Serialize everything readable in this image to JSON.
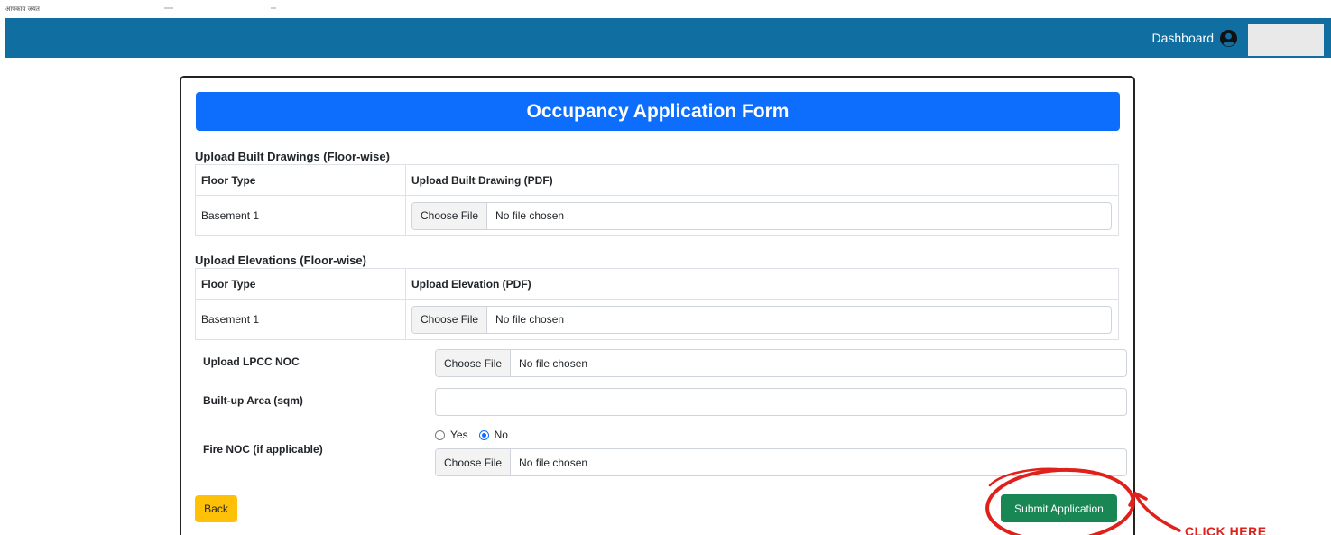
{
  "topbar": {
    "tiny_text": "आपकाय जयत"
  },
  "navbar": {
    "dashboard_label": "Dashboard",
    "user_icon": "user-circle-icon"
  },
  "form": {
    "title": "Occupancy Application Form",
    "built_drawings": {
      "section_title": "Upload Built Drawings (Floor-wise)",
      "headers": [
        "Floor Type",
        "Upload Built Drawing (PDF)"
      ],
      "rows": [
        {
          "floor_type": "Basement 1",
          "choose_label": "Choose File",
          "status": "No file chosen"
        }
      ]
    },
    "elevations": {
      "section_title": "Upload Elevations (Floor-wise)",
      "headers": [
        "Floor Type",
        "Upload Elevation (PDF)"
      ],
      "rows": [
        {
          "floor_type": "Basement 1",
          "choose_label": "Choose File",
          "status": "No file chosen"
        }
      ]
    },
    "lpcc_noc": {
      "label": "Upload LPCC NOC",
      "choose_label": "Choose File",
      "status": "No file chosen"
    },
    "built_up_area": {
      "label": "Built-up Area (sqm)",
      "value": ""
    },
    "fire_noc": {
      "label": "Fire NOC (if applicable)",
      "options": [
        "Yes",
        "No"
      ],
      "selected": "No",
      "choose_label": "Choose File",
      "status": "No file chosen"
    },
    "back_label": "Back",
    "submit_label": "Submit Application"
  },
  "annotation": {
    "text": "CLICK HERE",
    "color": "#e0201b"
  },
  "colors": {
    "navbar": "#106ea0",
    "header": "#0d6efd",
    "back": "#ffc107",
    "submit": "#198754"
  }
}
